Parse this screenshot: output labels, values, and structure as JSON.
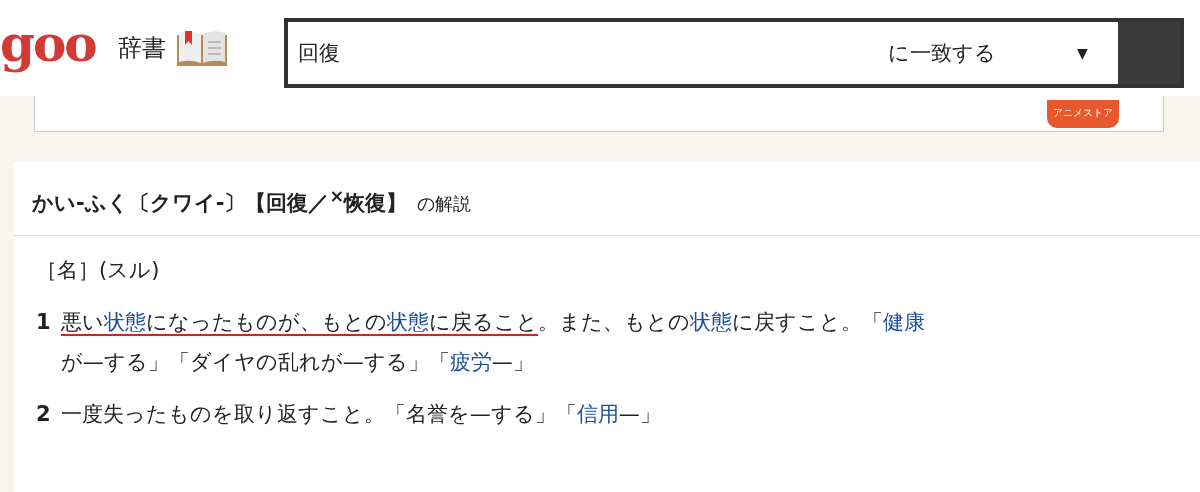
{
  "header": {
    "logo": "goo",
    "section": "辞書",
    "search": {
      "value": "回復",
      "match_mode": "に一致する",
      "dropdown_arrow": "▼"
    }
  },
  "ad": {
    "badge": "アニメストア"
  },
  "entry": {
    "headword": "かい-ふく〔クワイ-〕【回復／$^{×}$恢復】",
    "headword_suffix": "の解説",
    "grammar": "［名］(スル)",
    "senses": [
      {
        "number": "1",
        "segments": [
          {
            "text": "悪い",
            "link": false,
            "underlined": true
          },
          {
            "text": "状態",
            "link": true,
            "underlined": true
          },
          {
            "text": "になったものが、もとの",
            "link": false,
            "underlined": true
          },
          {
            "text": "状態",
            "link": true,
            "underlined": true
          },
          {
            "text": "に戻ること",
            "link": false,
            "underlined": true
          },
          {
            "text": "。また、もとの",
            "link": false,
            "underlined": false
          },
          {
            "text": "状態",
            "link": true,
            "underlined": false
          },
          {
            "text": "に戻すこと。「",
            "link": false,
            "underlined": false
          },
          {
            "text": "健康",
            "link": true,
            "underlined": false
          },
          {
            "text": "が—する」「ダイヤの乱れが—する」「",
            "link": false,
            "underlined": false
          },
          {
            "text": "疲労",
            "link": true,
            "underlined": false
          },
          {
            "text": "—」",
            "link": false,
            "underlined": false
          }
        ]
      },
      {
        "number": "2",
        "segments": [
          {
            "text": "一度失ったものを取り返すこと。「名誉を—する」「",
            "link": false,
            "underlined": false
          },
          {
            "text": "信用",
            "link": true,
            "underlined": false
          },
          {
            "text": "—」",
            "link": false,
            "underlined": false
          }
        ]
      }
    ]
  }
}
